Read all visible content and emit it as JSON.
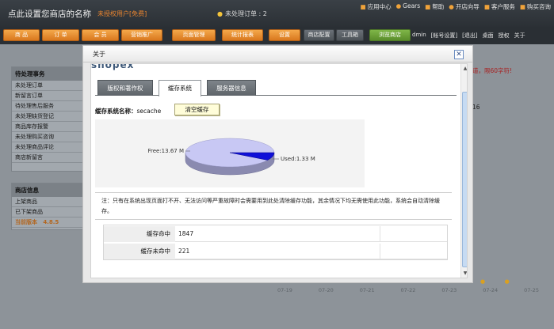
{
  "header": {
    "store_name": "点此设置您商店的名称",
    "unauthorized": "未授权用户[免费]",
    "pending_orders": "未处理订单 : 2",
    "links": [
      "应用中心",
      "Gears",
      "帮助",
      "开店向导",
      "客户服务",
      "购买咨询"
    ]
  },
  "nav": {
    "tabs": [
      "商 品",
      "订 单",
      "会 员",
      "营销推广",
      "页面管理",
      "统计报表",
      "设置",
      "商店配置",
      "工具箱",
      "浏览商店"
    ],
    "user_links": [
      "dmin",
      "[帐号设置]",
      "[退出]",
      "桌面",
      "授权",
      "关于"
    ]
  },
  "sidebar": {
    "todo_title": "待处理事务",
    "todo_items": [
      "未处理订单",
      "新留言订单",
      "待处理售后服务",
      "未处理缺货登记",
      "商品库存报警",
      "未处理购买咨询",
      "未处理商品评论",
      "商店新留言"
    ],
    "store_info_title": "商店信息",
    "store_info_items": [
      "上架商品",
      "已下架商品",
      "当前版本"
    ],
    "version": "4.8.5"
  },
  "background": {
    "warning": "道，限60字符!",
    "number": "16",
    "dates": [
      "07-19",
      "07-20",
      "07-21",
      "07-22",
      "07-23",
      "07-24",
      "07-25"
    ]
  },
  "modal": {
    "title": "关于",
    "logo_text": "shopex",
    "tabs": [
      "版权和著作权",
      "缓存系统",
      "服务器信息"
    ],
    "active_tab": 1,
    "cache_name_label": "缓存系统名称：",
    "cache_name_value": "secache",
    "clear_button": "清空缓存",
    "note": "注：只有在系统出现页面打不开、无法访问等严重故障时会需要用到此处清除缓存功能，其余情况下均无需使用此功能，系统会自动清除缓存。",
    "stats": [
      {
        "label": "缓存命中",
        "value": "1847"
      },
      {
        "label": "缓存未命中",
        "value": "221"
      }
    ]
  },
  "chart_data": {
    "type": "pie",
    "categories": [
      "Free",
      "Used"
    ],
    "values": [
      13.67,
      1.33
    ],
    "labels": [
      "Free:13.67 M",
      "Used:1.33 M"
    ],
    "colors": {
      "Free": "#c8c8f4",
      "Used": "#1010d8",
      "side": "#8a8ab0"
    }
  },
  "colors": {
    "accent": "#e8842f",
    "nav_orange": "#d9781e",
    "clear_button_bg": "#fffdd9"
  }
}
